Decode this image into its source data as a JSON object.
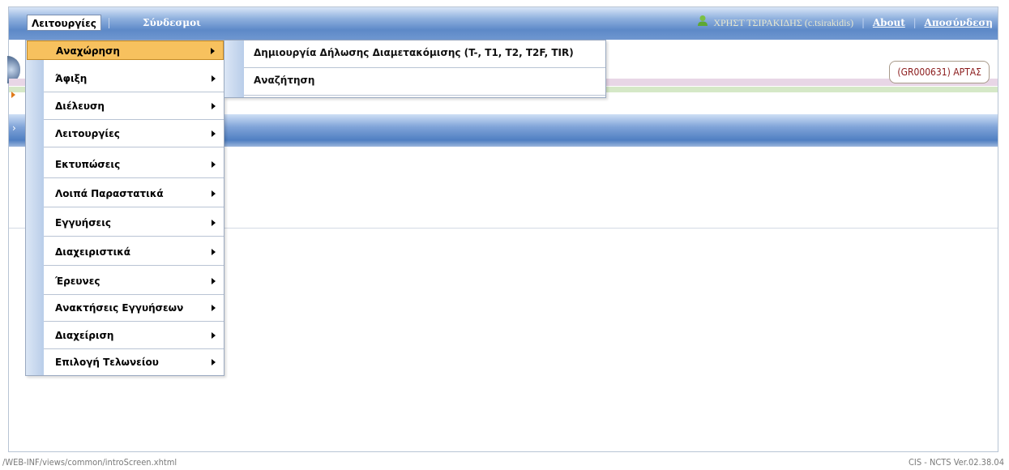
{
  "menubar": {
    "main_menu": "Λειτουργίες",
    "links_menu": "Σύνδεσμοι",
    "user_name": "ΧΡΗΣΤ ΤΣΙΡΑΚΙΔΗΣ (c.tsirakidis)",
    "about": "About",
    "logout": "Αποσύνδεση"
  },
  "header": {
    "customs_office": "(GR000631) ΑΡΤΑΣ"
  },
  "dropdown": {
    "items": [
      {
        "label": "Αναχώρηση"
      },
      {
        "label": "Άφιξη"
      },
      {
        "label": "Διέλευση"
      },
      {
        "label": "Λειτουργίες"
      },
      {
        "label": "Εκτυπώσεις"
      },
      {
        "label": "Λοιπά Παραστατικά"
      },
      {
        "label": "Εγγυήσεις"
      },
      {
        "label": "Διαχειριστικά"
      },
      {
        "label": "Έρευνες"
      },
      {
        "label": "Ανακτήσεις Εγγυήσεων"
      },
      {
        "label": "Διαχείριση"
      },
      {
        "label": "Επιλογή Τελωνείου"
      }
    ]
  },
  "submenu": {
    "items": [
      {
        "label": "Δημιουργία Δήλωσης Διαμετακόμισης (T-, T1, T2, T2F, TIR)"
      },
      {
        "label": "Αναζήτηση"
      }
    ]
  },
  "footer": {
    "path": "/WEB-INF/views/common/introScreen.xhtml",
    "version": "CIS - NCTS Ver.02.38.04"
  },
  "colors": {
    "active_item": "#f7c15e",
    "menubar_blue": "#5d89c8",
    "office_text": "#8a1a1a"
  }
}
